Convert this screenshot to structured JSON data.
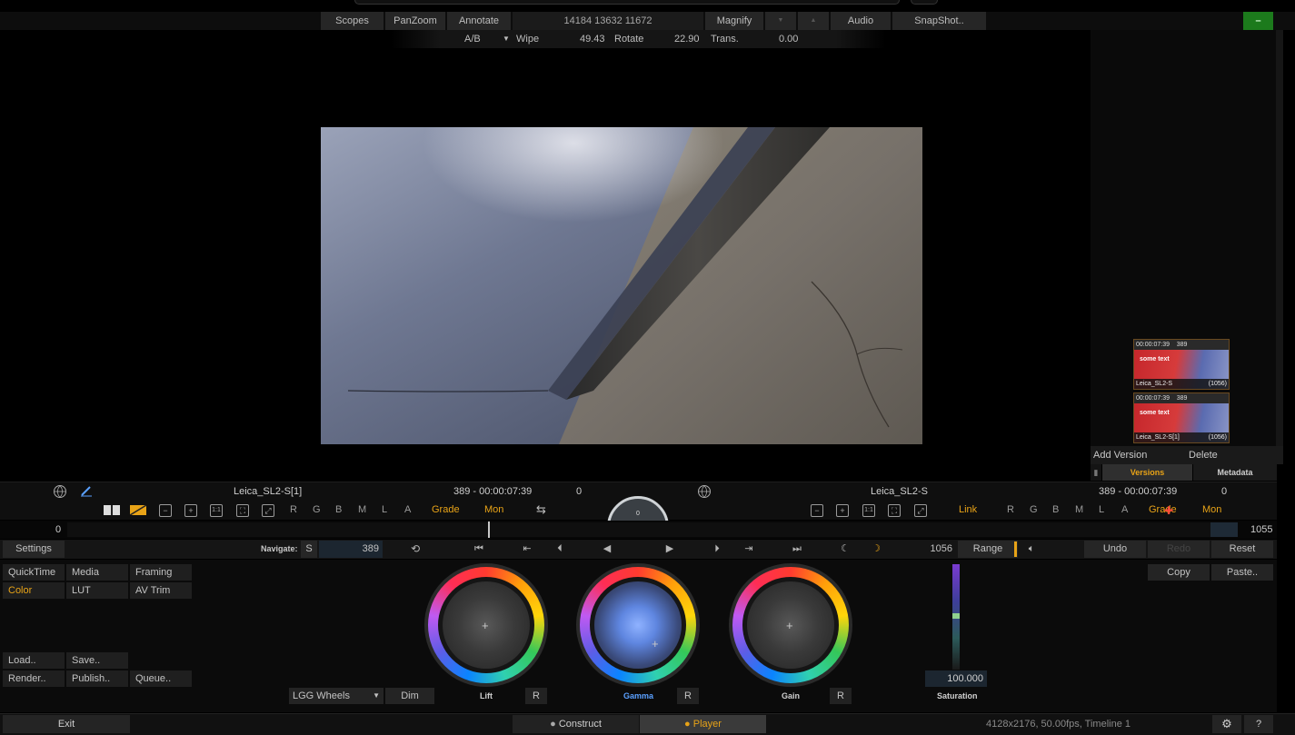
{
  "top_toolbar": {
    "scopes": "Scopes",
    "panzoom": "PanZoom",
    "annotate": "Annotate",
    "coords": "14184  13632  11672",
    "magnify": "Magnify",
    "arrow_down": "▼",
    "arrow_up": "▲",
    "audio": "Audio",
    "snapshot": "SnapShot..",
    "green_button": "–"
  },
  "sub_toolbar": {
    "mode": "A/B",
    "mode_arrow": "▼",
    "wipe_label": "Wipe",
    "wipe_value": "49.43",
    "rotate_label": "Rotate",
    "rotate_value": "22.90",
    "trans_label": "Trans.",
    "trans_value": "0.00"
  },
  "versions": {
    "thumbs": [
      {
        "timecode": "00:00:07:39",
        "frame": "389",
        "caption": "some text",
        "name": "Leica_SL2-S",
        "count": "(1056)"
      },
      {
        "timecode": "00:00:07:39",
        "frame": "389",
        "caption": "some text",
        "name": "Leica_SL2-S[1]",
        "count": "(1056)"
      }
    ],
    "add_version": "Add Version",
    "delete": "Delete",
    "tab_versions": "Versions",
    "tab_metadata": "Metadata"
  },
  "left_info": {
    "clip_name": "Leica_SL2-S[1]",
    "frame_tc": "389  -  00:00:07:39",
    "zero": "0",
    "channels": [
      "R",
      "G",
      "B",
      "M",
      "L",
      "A"
    ],
    "grade": "Grade",
    "mon": "Mon"
  },
  "right_info": {
    "clip_name": "Leica_SL2-S",
    "frame_tc": "389  -  00:00:07:39",
    "zero": "0",
    "link": "Link",
    "channels": [
      "R",
      "G",
      "B",
      "M",
      "L",
      "A"
    ],
    "grade": "Grade",
    "mon": "Mon"
  },
  "center_dial": "0",
  "timeline": {
    "start": "0",
    "end": "1055"
  },
  "navbar": {
    "settings": "Settings",
    "navigate_label": "Navigate:",
    "s_button": "S",
    "current_frame": "389",
    "end_frame": "1056",
    "range": "Range",
    "undo": "Undo",
    "redo": "Redo",
    "reset": "Reset"
  },
  "left_menu": {
    "quicktime": "QuickTime",
    "media": "Media",
    "framing": "Framing",
    "color": "Color",
    "lut": "LUT",
    "av_trim": "AV Trim",
    "load": "Load..",
    "save": "Save..",
    "render": "Render..",
    "publish": "Publish..",
    "queue": "Queue.."
  },
  "color_panel": {
    "wheel_mode": "LGG Wheels",
    "wheel_mode_arrow": "▼",
    "dim": "Dim",
    "lift": "Lift",
    "gamma": "Gamma",
    "gain": "Gain",
    "reset_r": "R",
    "saturation_value": "100.000",
    "saturation_label": "Saturation",
    "copy": "Copy",
    "paste": "Paste.."
  },
  "bottom_bar": {
    "exit": "Exit",
    "construct": "Construct",
    "player": "Player",
    "status": "4128x2176, 50.00fps, Timeline 1",
    "help": "?"
  },
  "colors": {
    "accent_orange": "#e8a317",
    "gamma_blue": "#5aa0ff",
    "green_button": "#1c7a1c"
  }
}
